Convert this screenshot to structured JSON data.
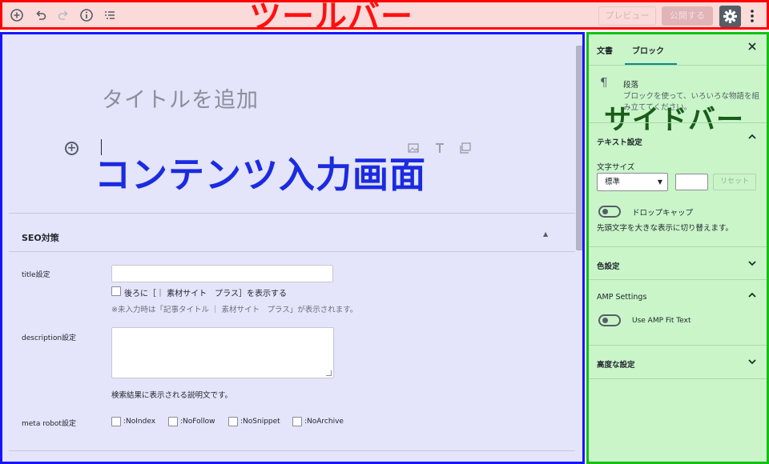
{
  "toolbar": {
    "overlay_label": "ツールバー",
    "preview_label": "プレビュー",
    "publish_label": "公開する"
  },
  "editor": {
    "overlay_label": "コンテンツ入力画面",
    "title_placeholder": "タイトルを追加"
  },
  "seo": {
    "section_title": "SEO対策",
    "title_label": "title設定",
    "title_value": "",
    "append_checkbox_label": "後ろに［｜ 素材サイト　プラス］を表示する",
    "title_note": "※未入力時は「記事タイトル ｜ 素材サイト　プラス」が表示されます。",
    "description_label": "description設定",
    "description_value": "",
    "description_note": "検索結果に表示される説明文です。",
    "robots_label": "meta robot設定",
    "robots_options": [
      ":NoIndex",
      ":NoFollow",
      ":NoSnippet",
      ":NoArchive"
    ]
  },
  "sidebar": {
    "overlay_label": "サイドバー",
    "tabs": [
      {
        "label": "文書",
        "active": false
      },
      {
        "label": "ブロック",
        "active": true
      }
    ],
    "block_name": "段落",
    "block_description": "ブロックを使って、いろいろな物語を組み立ててください。",
    "panels": {
      "text_settings": "テキスト設定",
      "font_size_label": "文字サイズ",
      "font_size_selected": "標準",
      "font_size_custom": "",
      "reset_label": "リセット",
      "drop_cap_label": "ドロップキャップ",
      "drop_cap_help": "先頭文字を大きな表示に切り替えます。",
      "color_settings": "色設定",
      "amp_settings": "AMP Settings",
      "amp_fit_text": "Use AMP Fit Text",
      "advanced": "高度な設定"
    }
  },
  "colors": {
    "toolbar_highlight": "#ff0000",
    "content_highlight": "#1515ff",
    "sidebar_highlight": "#14c014",
    "accent": "#0a8c8a"
  },
  "icons": {
    "add": "plus-circle-icon",
    "undo": "undo-icon",
    "redo": "redo-icon",
    "info": "info-icon",
    "outline": "list-outline-icon",
    "settings": "gear-icon",
    "more": "more-vertical-icon",
    "paragraph": "paragraph-icon",
    "close": "close-icon"
  }
}
